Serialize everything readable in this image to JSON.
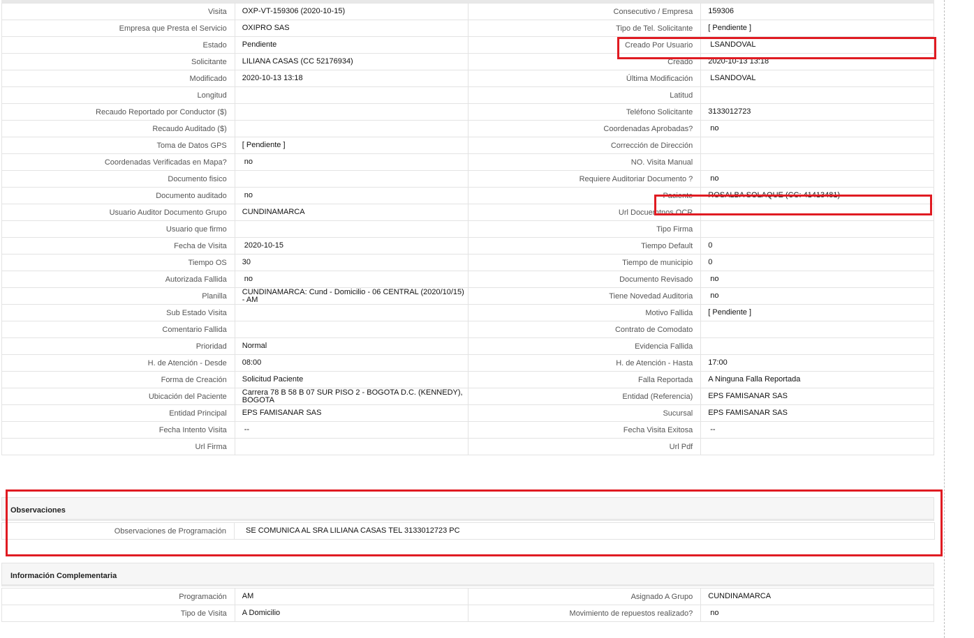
{
  "main_rows": [
    {
      "l1": "Visita",
      "v1": "OXP-VT-159306 (2020-10-15)",
      "l2": "Consecutivo / Empresa",
      "v2": "159306"
    },
    {
      "l1": "Empresa que Presta el Servicio",
      "v1": "OXIPRO SAS",
      "l2": "Tipo de Tel. Solicitante",
      "v2": "[ Pendiente ]"
    },
    {
      "l1": "Estado",
      "v1": "Pendiente",
      "l2": "Creado Por Usuario",
      "v2": "LSANDOVAL"
    },
    {
      "l1": "Solicitante",
      "v1": "LILIANA CASAS (CC 52176934)",
      "l2": "Creado",
      "v2": "2020-10-13 13:18"
    },
    {
      "l1": "Modificado",
      "v1": "2020-10-13 13:18",
      "l2": "Última Modificación",
      "v2": "LSANDOVAL"
    },
    {
      "l1": "Longitud",
      "v1": "",
      "l2": "Latitud",
      "v2": ""
    },
    {
      "l1": "Recaudo Reportado por Conductor ($)",
      "v1": "",
      "l2": "Teléfono Solicitante",
      "v2": "3133012723"
    },
    {
      "l1": "Recaudo Auditado ($)",
      "v1": "",
      "l2": "Coordenadas Aprobadas?",
      "v2": "no"
    },
    {
      "l1": "Toma de Datos GPS",
      "v1": "[ Pendiente ]",
      "l2": "Corrección de Dirección",
      "v2": ""
    },
    {
      "l1": "Coordenadas Verificadas en Mapa?",
      "v1": "no",
      "l2": "NO. Visita Manual",
      "v2": ""
    },
    {
      "l1": "Documento fisico",
      "v1": "",
      "l2": "Requiere Auditoriar Documento ?",
      "v2": "no"
    },
    {
      "l1": "Documento auditado",
      "v1": "no",
      "l2": "Paciente",
      "v2": "ROSALBA SOLAQUE (CC: 41413481)"
    },
    {
      "l1": "Usuario Auditor Documento Grupo",
      "v1": "CUNDINAMARCA",
      "l2": "Url Docuemtnos OCR",
      "v2": ""
    },
    {
      "l1": "Usuario que firmo",
      "v1": "",
      "l2": "Tipo Firma",
      "v2": ""
    },
    {
      "l1": "Fecha de Visita",
      "v1": "2020-10-15",
      "l2": "Tiempo Default",
      "v2": "0"
    },
    {
      "l1": "Tiempo OS",
      "v1": "30",
      "l2": "Tiempo de municipio",
      "v2": "0"
    },
    {
      "l1": "Autorizada Fallida",
      "v1": "no",
      "l2": "Documento Revisado",
      "v2": "no"
    },
    {
      "l1": "Planilla",
      "v1": "CUNDINAMARCA: Cund - Domicilio - 06 CENTRAL (2020/10/15) - AM",
      "l2": "Tiene Novedad Auditoria",
      "v2": "no"
    },
    {
      "l1": "Sub Estado Visita",
      "v1": "",
      "l2": "Motivo Fallida",
      "v2": "[ Pendiente ]"
    },
    {
      "l1": "Comentario Fallida",
      "v1": "",
      "l2": "Contrato de Comodato",
      "v2": ""
    },
    {
      "l1": "Prioridad",
      "v1": "Normal",
      "l2": "Evidencia Fallida",
      "v2": ""
    },
    {
      "l1": "H. de Atención - Desde",
      "v1": "08:00",
      "l2": "H. de Atención - Hasta",
      "v2": "17:00"
    },
    {
      "l1": "Forma de Creación",
      "v1": "Solicitud Paciente",
      "l2": "Falla Reportada",
      "v2": "A Ninguna Falla Reportada"
    },
    {
      "l1": "Ubicación del Paciente",
      "v1": "Carrera 78 B 58 B 07 SUR PISO 2 - BOGOTA D.C. (KENNEDY), BOGOTA",
      "l2": "Entidad (Referencia)",
      "v2": "EPS FAMISANAR SAS"
    },
    {
      "l1": "Entidad Principal",
      "v1": "EPS FAMISANAR SAS",
      "l2": "Sucursal",
      "v2": "EPS FAMISANAR SAS"
    },
    {
      "l1": "Fecha Intento Visita",
      "v1": "--",
      "l2": "Fecha Visita Exitosa",
      "v2": "--"
    },
    {
      "l1": "Url Firma",
      "v1": "",
      "l2": "Url Pdf",
      "v2": ""
    }
  ],
  "observaciones": {
    "title": "Observaciones",
    "label": "Observaciones de Programación",
    "value": "SE COMUNICA AL SRA LILIANA CASAS TEL 3133012723 PC"
  },
  "info": {
    "title": "Información Complementaria",
    "rows": [
      {
        "l1": "Programación",
        "v1": "AM",
        "l2": "Asignado A Grupo",
        "v2": "CUNDINAMARCA"
      },
      {
        "l1": "Tipo de Visita",
        "v1": "A Domicilio",
        "l2": "Movimiento de repuestos realizado?",
        "v2": "no"
      }
    ]
  },
  "colors": {
    "highlight": "#e01b22",
    "border": "#e3e3e3",
    "section_bg": "#f6f6f6"
  }
}
